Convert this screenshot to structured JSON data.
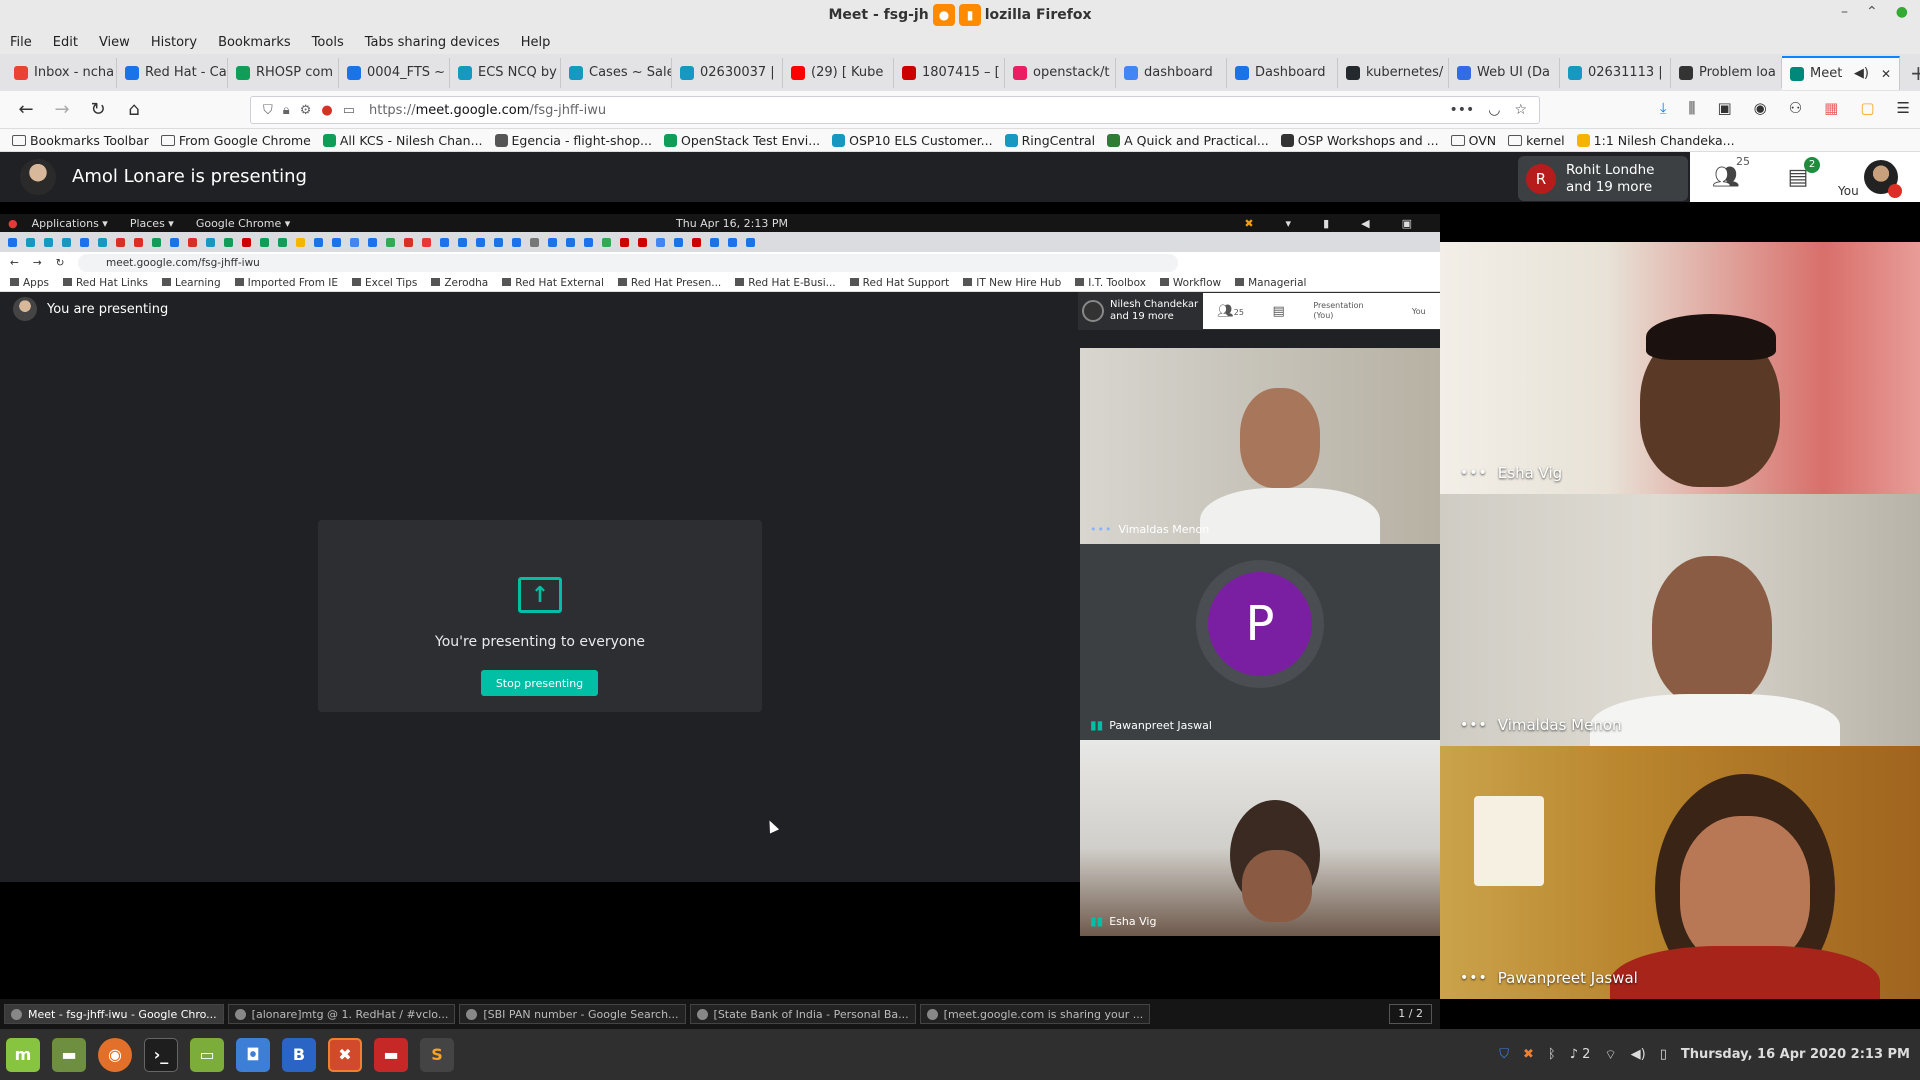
{
  "window": {
    "title": "Meet - fsg-jhff-iwu - Mozilla Firefox",
    "title_left": "Meet - fsg-jh",
    "title_right": "lozilla Firefox"
  },
  "menubar": [
    "File",
    "Edit",
    "View",
    "History",
    "Bookmarks",
    "Tools",
    "Tabs sharing devices",
    "Help"
  ],
  "tabs": [
    {
      "label": "Inbox - ncha",
      "color": "#ea4335"
    },
    {
      "label": "Red Hat - Ca",
      "color": "#1a73e8"
    },
    {
      "label": "RHOSP com",
      "color": "#0f9d58"
    },
    {
      "label": "0004_FTS ~",
      "color": "#1a73e8"
    },
    {
      "label": "ECS NCQ by",
      "color": "#1798c1"
    },
    {
      "label": "Cases ~ Sale",
      "color": "#1798c1"
    },
    {
      "label": "02630037 |",
      "color": "#1798c1"
    },
    {
      "label": "(29) [ Kube",
      "color": "#ff0000"
    },
    {
      "label": "1807415 – [",
      "color": "#cc0000"
    },
    {
      "label": "openstack/t",
      "color": "#e91e63"
    },
    {
      "label": "dashboard",
      "color": "#4285f4"
    },
    {
      "label": "Dashboard",
      "color": "#1a73e8"
    },
    {
      "label": "kubernetes/",
      "color": "#24292e"
    },
    {
      "label": "Web UI (Da",
      "color": "#326ce5"
    },
    {
      "label": "02631113 |",
      "color": "#1798c1"
    },
    {
      "label": "Problem loa",
      "color": "#333333"
    },
    {
      "label": "Meet",
      "color": "#00897b",
      "active": true
    }
  ],
  "url": {
    "prefix": "https://",
    "host": "meet.google.com",
    "path": "/fsg-jhff-iwu"
  },
  "bookmarks": [
    {
      "label": "Bookmarks Toolbar",
      "kind": "folder"
    },
    {
      "label": "From Google Chrome",
      "kind": "folder"
    },
    {
      "label": "All KCS - Nilesh Chan...",
      "kind": "sheet"
    },
    {
      "label": "Egencia - flight-shop...",
      "kind": "plane"
    },
    {
      "label": "OpenStack Test Envi...",
      "kind": "sheet"
    },
    {
      "label": "OSP10 ELS Customer...",
      "kind": "cloud"
    },
    {
      "label": "RingCentral",
      "kind": "cloud"
    },
    {
      "label": "A Quick and Practical...",
      "kind": "a"
    },
    {
      "label": "OSP Workshops and ...",
      "kind": "info"
    },
    {
      "label": "OVN",
      "kind": "folder"
    },
    {
      "label": "kernel",
      "kind": "folder"
    },
    {
      "label": "1:1 Nilesh Chandeka...",
      "kind": "note"
    }
  ],
  "meet": {
    "presenting_banner": "Amol Lonare is presenting",
    "speaker_initial": "R",
    "speaker_name": "Rohit Londhe",
    "speaker_more": "and 19 more",
    "participants_count": "25",
    "chat_badge": "2",
    "you_label": "You"
  },
  "shared_screen": {
    "gnome": {
      "applications": "Applications ▾",
      "places": "Places ▾",
      "browser": "Google Chrome ▾",
      "clock": "Thu Apr 16,  2:13 PM"
    },
    "chrome_url": "meet.google.com/fsg-jhff-iwu",
    "chrome_bookmarks": [
      "Apps",
      "Red Hat Links",
      "Learning",
      "Imported From IE",
      "Excel Tips",
      "Zerodha",
      "Red Hat External",
      "Red Hat Presen...",
      "Red Hat E-Busi...",
      "Red Hat Support",
      "IT New Hire Hub",
      "I.T. Toolbox",
      "Workflow",
      "Managerial"
    ],
    "you_are_presenting": "You are presenting",
    "presenting_card": {
      "message": "You're presenting to everyone",
      "button": "Stop presenting"
    },
    "inner_speaker": "Nilesh Chandekar",
    "inner_speaker_more": "and 19 more",
    "inner_count": "25",
    "inner_presentation": "Presentation (You)",
    "inner_you": "You",
    "inner_tiles": [
      {
        "name": "Vimaldas Menon",
        "kind": "video"
      },
      {
        "name": "Pawanpreet Jaswal",
        "kind": "avatar",
        "initial": "P"
      },
      {
        "name": "Esha Vig",
        "kind": "video"
      }
    ],
    "taskbar": [
      "Meet - fsg-jhff-iwu - Google Chro...",
      "[alonare]mtg @ 1. RedHat / #vclo...",
      "[SBI PAN number - Google Search...",
      "[State Bank of India - Personal Ba...",
      "[meet.google.com is sharing your ..."
    ],
    "pager": "1 / 2"
  },
  "tiles": [
    {
      "name": "Esha Vig"
    },
    {
      "name": "Vimaldas Menon"
    },
    {
      "name": "Pawanpreet Jaswal"
    }
  ],
  "panel": {
    "clock": "Thursday, 16 Apr 2020  2:13 PM",
    "notif_count": "2"
  }
}
